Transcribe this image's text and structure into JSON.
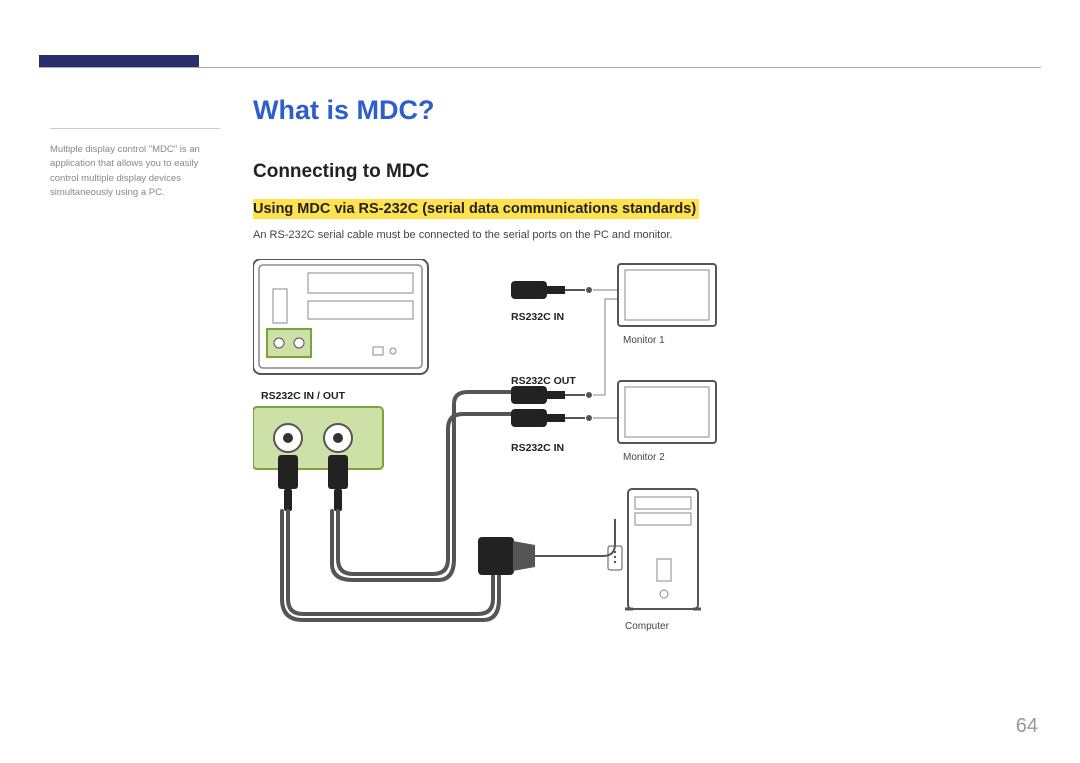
{
  "page_number": "64",
  "side_note": "Multiple display control \"MDC\" is an application that allows you to easily control multiple display devices simultaneously using a PC.",
  "title": "What is MDC?",
  "section": "Connecting to MDC",
  "subsection": "Using MDC via RS-232C (serial data communications standards)",
  "body": "An RS-232C serial cable must be connected to the serial ports on the PC and monitor.",
  "labels": {
    "inout": "RS232C IN / OUT",
    "in1": "RS232C IN",
    "out": "RS232C OUT",
    "in2": "RS232C IN",
    "monitor1": "Monitor 1",
    "monitor2": "Monitor 2",
    "computer": "Computer"
  }
}
